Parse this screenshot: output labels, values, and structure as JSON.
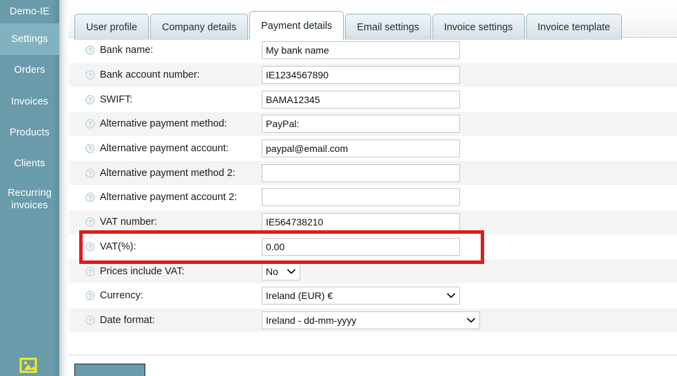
{
  "sidebar": {
    "brand": "Demo-IE",
    "items": [
      {
        "label": "Demo-IE",
        "name": "brand",
        "active": false
      },
      {
        "label": "Settings",
        "name": "settings",
        "active": true
      },
      {
        "label": "Orders",
        "name": "orders",
        "active": false
      },
      {
        "label": "Invoices",
        "name": "invoices",
        "active": false
      },
      {
        "label": "Products",
        "name": "products",
        "active": false
      },
      {
        "label": "Clients",
        "name": "clients",
        "active": false
      },
      {
        "label": "Recurring invoices",
        "name": "recurring-invoices",
        "active": false
      }
    ],
    "bottom_icon": "image-icon",
    "colors": {
      "background": "#6a9baa",
      "active": "#82b2c0",
      "icon": "#f5ec1a"
    }
  },
  "tabs": [
    {
      "label": "User profile",
      "name": "user-profile",
      "active": false
    },
    {
      "label": "Company details",
      "name": "company-details",
      "active": false
    },
    {
      "label": "Payment details",
      "name": "payment-details",
      "active": true
    },
    {
      "label": "Email settings",
      "name": "email-settings",
      "active": false
    },
    {
      "label": "Invoice settings",
      "name": "invoice-settings",
      "active": false
    },
    {
      "label": "Invoice template",
      "name": "invoice-template",
      "active": false
    }
  ],
  "form": {
    "help_icon": "help-circle-icon",
    "rows": [
      {
        "name": "bank-name",
        "label": "Bank name:",
        "type": "text",
        "value": "My bank name",
        "placeholder": "",
        "striped": false
      },
      {
        "name": "bank-account-number",
        "label": "Bank account number:",
        "type": "text",
        "value": "IE1234567890",
        "placeholder": "",
        "striped": true
      },
      {
        "name": "swift",
        "label": "SWIFT:",
        "type": "text",
        "value": "BAMA12345",
        "placeholder": "",
        "striped": false
      },
      {
        "name": "alternative-payment-method",
        "label": "Alternative payment method:",
        "type": "text",
        "value": "PayPal:",
        "placeholder": "",
        "striped": true
      },
      {
        "name": "alternative-payment-account",
        "label": "Alternative payment account:",
        "type": "text",
        "value": "paypal@email.com",
        "placeholder": "",
        "striped": false
      },
      {
        "name": "alternative-payment-method-2",
        "label": "Alternative payment method 2:",
        "type": "text",
        "value": "",
        "placeholder": "",
        "striped": true
      },
      {
        "name": "alternative-payment-account-2",
        "label": "Alternative payment account 2:",
        "type": "text",
        "value": "",
        "placeholder": "",
        "striped": false
      },
      {
        "name": "vat-number",
        "label": "VAT number:",
        "type": "text",
        "value": "IE564738210",
        "placeholder": "",
        "striped": true
      },
      {
        "name": "vat-percent",
        "label": "VAT(%):",
        "type": "text",
        "value": "0.00",
        "placeholder": "",
        "striped": false,
        "highlighted": true
      },
      {
        "name": "prices-include-vat",
        "label": "Prices include VAT:",
        "type": "select-small",
        "value": "No",
        "placeholder": "",
        "striped": true
      },
      {
        "name": "currency",
        "label": "Currency:",
        "type": "select-currency",
        "value": "Ireland (EUR) €",
        "placeholder": "",
        "striped": false
      },
      {
        "name": "date-format",
        "label": "Date format:",
        "type": "select-dateformat",
        "value": "Ireland - dd-mm-yyyy",
        "placeholder": "",
        "striped": true
      }
    ]
  },
  "highlight": {
    "target": "vat-percent",
    "color": "#e01b1b"
  },
  "footer": {
    "save_label": ""
  }
}
